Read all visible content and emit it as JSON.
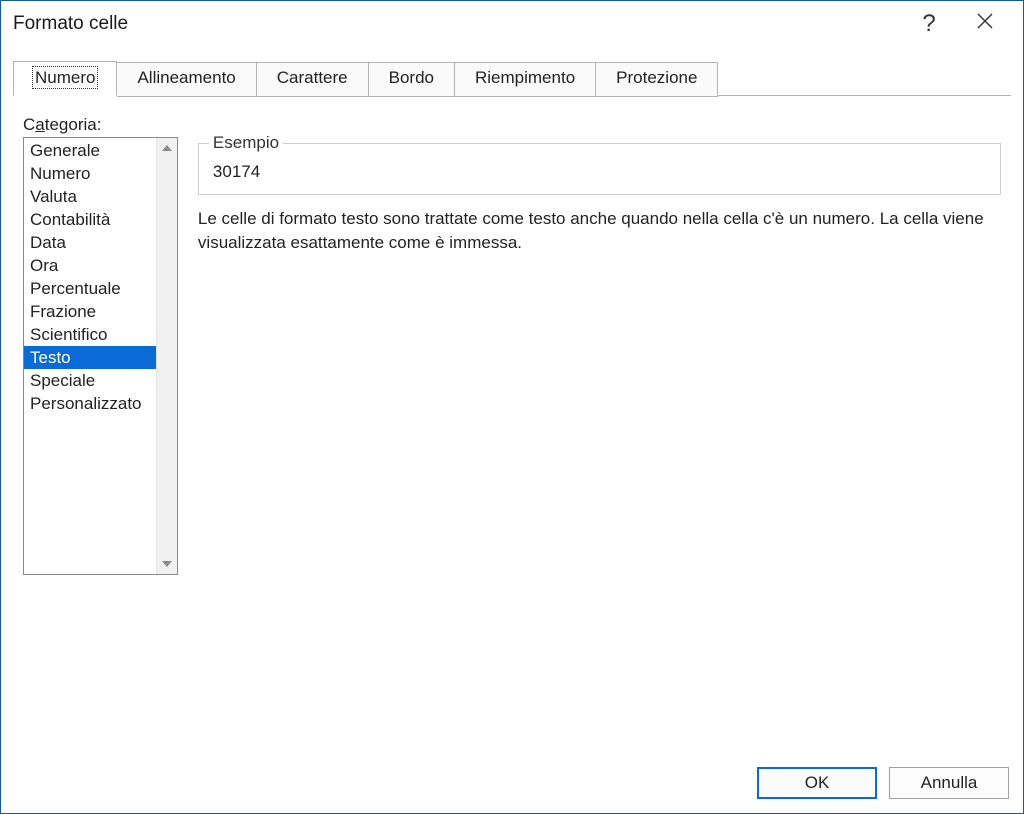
{
  "window": {
    "title": "Formato celle"
  },
  "tabs": [
    {
      "label": "Numero",
      "active": true
    },
    {
      "label": "Allineamento",
      "active": false
    },
    {
      "label": "Carattere",
      "active": false
    },
    {
      "label": "Bordo",
      "active": false
    },
    {
      "label": "Riempimento",
      "active": false
    },
    {
      "label": "Protezione",
      "active": false
    }
  ],
  "category": {
    "label_prefix": "C",
    "label_underlined": "a",
    "label_suffix": "tegoria:",
    "items": [
      "Generale",
      "Numero",
      "Valuta",
      "Contabilità",
      "Data",
      "Ora",
      "Percentuale",
      "Frazione",
      "Scientifico",
      "Testo",
      "Speciale",
      "Personalizzato"
    ],
    "selected_index": 9
  },
  "sample": {
    "legend": "Esempio",
    "value": "30174"
  },
  "description": "Le celle di formato testo sono trattate come testo anche quando nella cella c'è un numero. La cella viene visualizzata esattamente come è immessa.",
  "buttons": {
    "ok": "OK",
    "cancel": "Annulla"
  }
}
